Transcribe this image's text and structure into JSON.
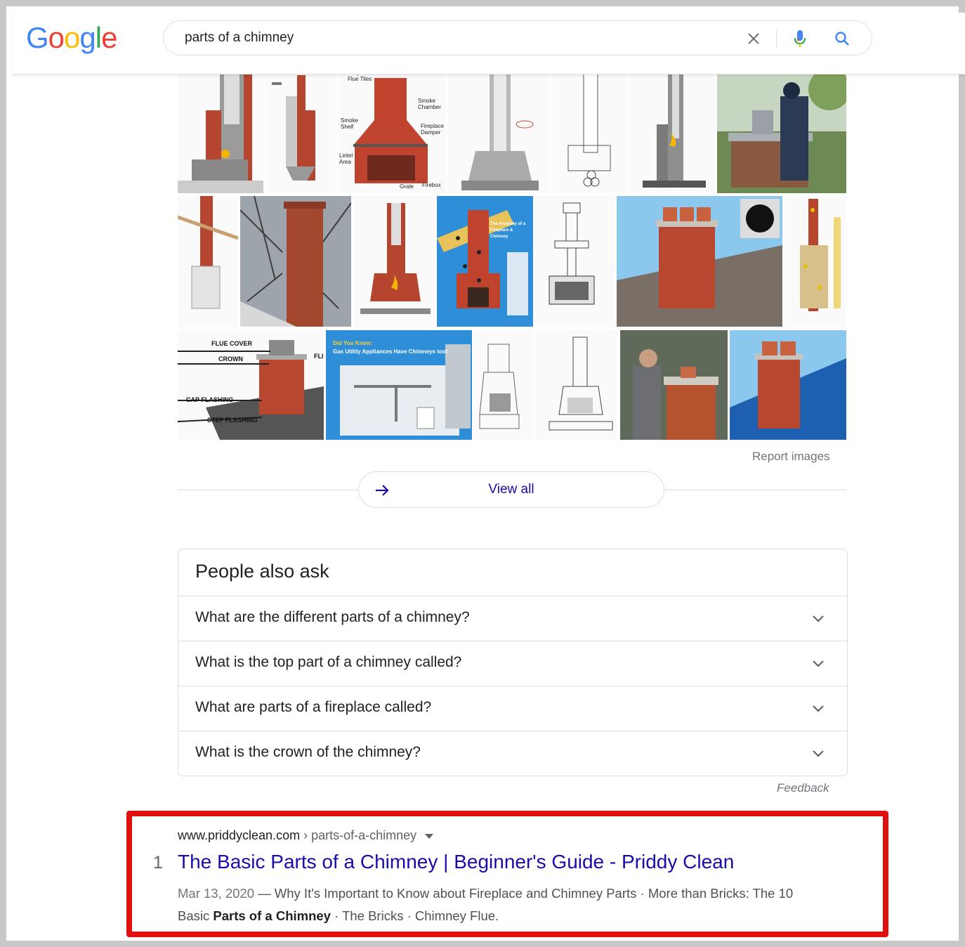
{
  "logo": {
    "letters": [
      "G",
      "o",
      "o",
      "g",
      "l",
      "e"
    ],
    "colors": [
      "#4285f4",
      "#ea4335",
      "#fbbc05",
      "#4285f4",
      "#34a853",
      "#ea4335"
    ]
  },
  "search": {
    "query": "parts of a chimney"
  },
  "icons": {
    "clear": "close-icon",
    "mic": "microphone-icon",
    "search": "search-icon",
    "arrow": "arrow-right-icon",
    "chevron": "chevron-down-icon",
    "caret": "caret-down-icon"
  },
  "images": {
    "captions": {
      "flue_tiles": "Fireplace Flue Tiles",
      "smoke_chamber": "Smoke Chamber",
      "smoke_shelf": "Smoke Shelf",
      "fireplace_damper": "Fireplace Damper",
      "lintel_area": "Lintel Area",
      "grate": "Grate",
      "firebox": "Firebox",
      "flue_cover": "FLUE COVER",
      "crown": "CROWN",
      "cap_flashing": "CAP FLASHING",
      "step_flashing": "STEP FLASHING",
      "fli": "FLI",
      "did_you_know": "Did You Know:",
      "gas_utility": "Gas Utility Appliances Have Chimneys too!",
      "anatomy": "The Anatomy of a Fireplace & Chimney"
    },
    "report_label": "Report images",
    "view_all_label": "View all"
  },
  "people_also_ask": {
    "title": "People also ask",
    "questions": [
      "What are the different parts of a chimney?",
      "What is the top part of a chimney called?",
      "What are parts of a fireplace called?",
      "What is the crown of the chimney?"
    ],
    "feedback_label": "Feedback"
  },
  "result": {
    "rank": "1",
    "domain": "www.priddyclean.com",
    "path": " › parts-of-a-chimney",
    "title": "The Basic Parts of a Chimney | Beginner's Guide - Priddy Clean",
    "date": "Mar 13, 2020",
    "snippet_part1": " — Why It's Important to Know about Fireplace and Chimney Parts · More than Bricks: The 10 Basic ",
    "snippet_bold": "Parts of a Chimney",
    "snippet_part2": " · The Bricks · Chimney Flue."
  },
  "colors": {
    "link": "#1a0dab",
    "highlight": "#e01010",
    "brick": "#b5452f",
    "sky_blue": "#2e8fd8"
  }
}
